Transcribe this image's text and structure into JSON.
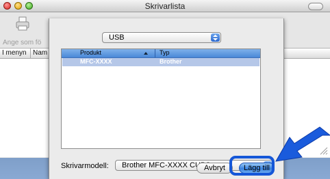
{
  "window": {
    "title": "Skrivarlista"
  },
  "toolbar": {
    "add_label": "Ange som fö"
  },
  "list": {
    "col1": "I menyn",
    "col2": "Nam"
  },
  "sheet": {
    "connection": "USB",
    "table": {
      "headers": [
        "Produkt",
        "Typ"
      ],
      "rows": [
        {
          "product": "MFC-XXXX",
          "type": "Brother"
        }
      ]
    },
    "model_label": "Skrivarmodell:",
    "model_value": "Brother MFC-XXXX CUPS.gz",
    "cancel_label": "Avbryt",
    "add_label": "Lägg till"
  },
  "colors": {
    "highlight": "#1557d8",
    "selection": "#b5c7e8",
    "header": "#4a88d8"
  }
}
